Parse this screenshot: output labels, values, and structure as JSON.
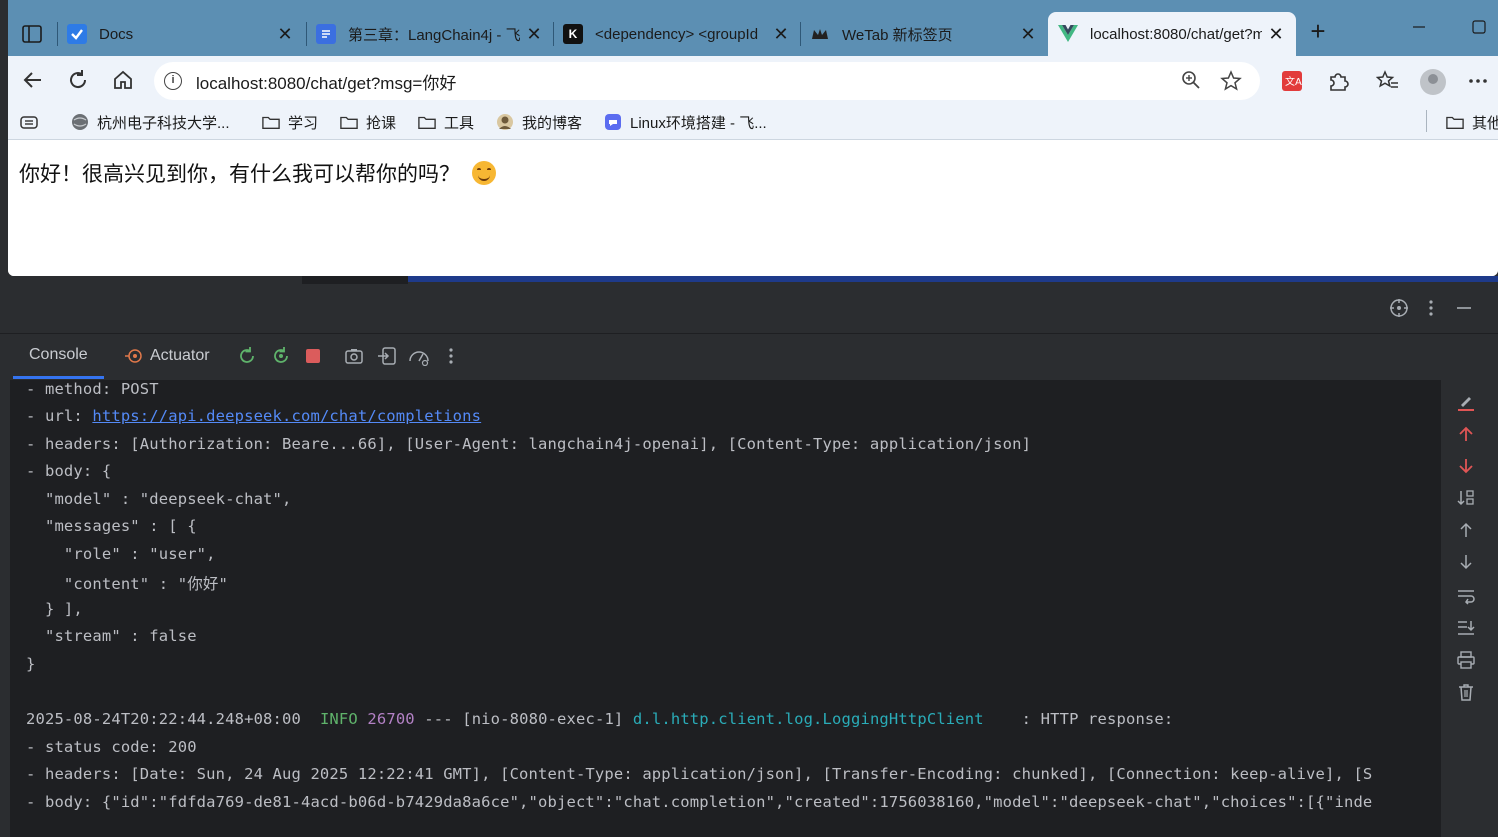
{
  "browser": {
    "tabs": [
      {
        "title": "Docs",
        "favicon_color": "#1a73e8",
        "favicon": "docs-icon",
        "active": false
      },
      {
        "title": "第三章：LangChain4j - 飞",
        "favicon_color": "#4285f4",
        "favicon": "document-icon",
        "active": false
      },
      {
        "title": "<dependency> <groupId",
        "favicon_color": "#111111",
        "favicon": "k-logo-icon",
        "active": false
      },
      {
        "title": "WeTab 新标签页",
        "favicon_color": "#222222",
        "favicon": "crown-icon",
        "active": false
      },
      {
        "title": "localhost:8080/chat/get?m",
        "favicon_color": "#42b883",
        "favicon": "vue-logo-icon",
        "active": true
      }
    ],
    "close_glyph": "✕",
    "new_tab_glyph": "+",
    "address": {
      "url": "localhost:8080/chat/get?msg=你好",
      "info_glyph": "i"
    },
    "bookmarks": [
      {
        "label": "",
        "icon": "reading-list-icon"
      },
      {
        "label": "杭州电子科技大学...",
        "icon": "globe-icon"
      },
      {
        "label": "学习",
        "icon": "folder-icon"
      },
      {
        "label": "抢课",
        "icon": "folder-icon"
      },
      {
        "label": "工具",
        "icon": "folder-icon"
      },
      {
        "label": "我的博客",
        "icon": "avatar-icon"
      },
      {
        "label": "Linux环境搭建 - 飞...",
        "icon": "feishu-icon"
      },
      {
        "label": "其他",
        "icon": "folder-icon"
      }
    ],
    "page_text": "你好！很高兴见到你，有什么我可以帮你的吗？"
  },
  "ide": {
    "run_tabs": [
      {
        "label": "Console",
        "active": true
      },
      {
        "label": "Actuator",
        "active": false
      }
    ],
    "console_lines": [
      "- method: POST",
      "- url: ",
      "- headers: [Authorization: Beare...66], [User-Agent: langchain4j-openai], [Content-Type: application/json]",
      "- body: {",
      "  \"model\" : \"deepseek-chat\",",
      "  \"messages\" : [ {",
      "    \"role\" : \"user\",",
      "    \"content\" : \"你好\"",
      "  } ],",
      "  \"stream\" : false",
      "}",
      "",
      "",
      "- status code: 200",
      "- headers: [Date: Sun, 24 Aug 2025 12:22:41 GMT], [Content-Type: application/json], [Transfer-Encoding: chunked], [Connection: keep-alive], [S",
      "- body: {\"id\":\"fdfda769-de81-4acd-b06d-b7429da8a6ce\",\"object\":\"chat.completion\",\"created\":1756038160,\"model\":\"deepseek-chat\",\"choices\":[{\"inde"
    ],
    "url_link": "https://api.deepseek.com/chat/completions",
    "log_entry": {
      "timestamp": "2025-08-24T20:22:44.248+08:00",
      "level": "INFO",
      "pid": "26700",
      "sep": "---",
      "thread": "[nio-8080-exec-1]",
      "logger": "d.l.http.client.log.LoggingHttpClient",
      "message": ": HTTP response:"
    }
  }
}
